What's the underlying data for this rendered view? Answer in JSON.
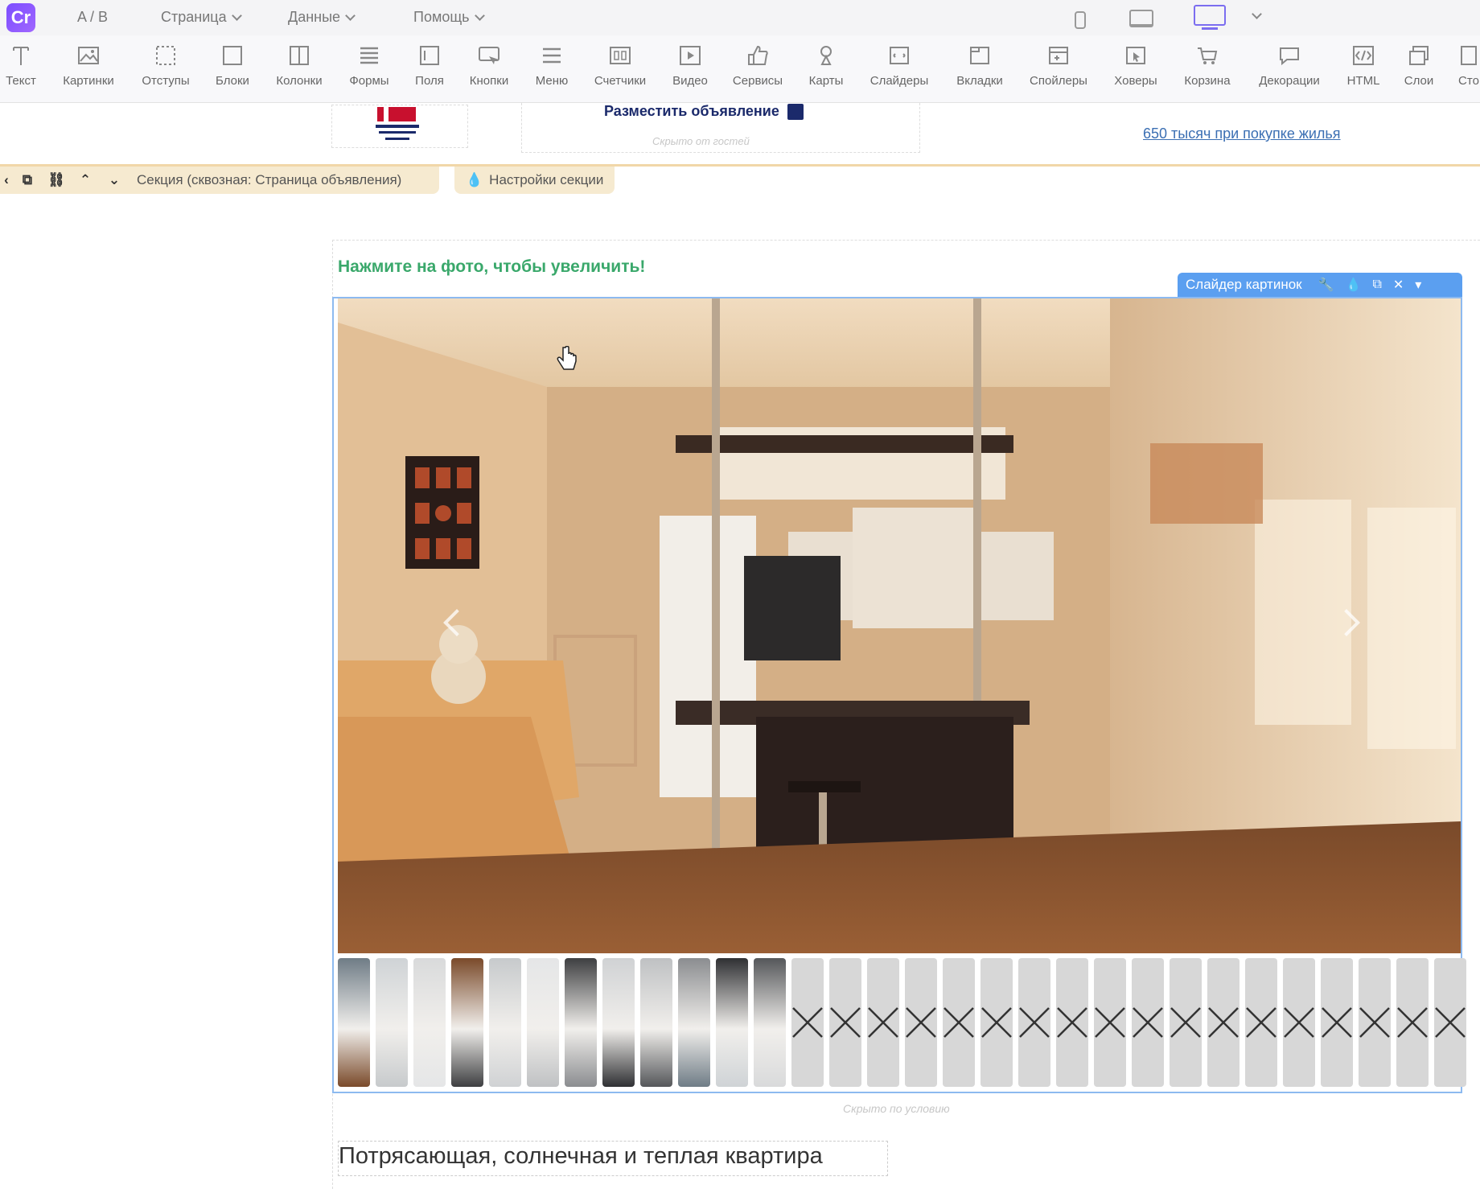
{
  "menubar": {
    "logo": "Cr",
    "ab": "A / B",
    "page": "Страница",
    "data": "Данные",
    "help": "Помощь"
  },
  "toolbar": [
    {
      "label": "Текст",
      "icon": "text-icon"
    },
    {
      "label": "Картинки",
      "icon": "image-icon"
    },
    {
      "label": "Отступы",
      "icon": "padding-icon"
    },
    {
      "label": "Блоки",
      "icon": "block-icon"
    },
    {
      "label": "Колонки",
      "icon": "columns-icon"
    },
    {
      "label": "Формы",
      "icon": "forms-icon"
    },
    {
      "label": "Поля",
      "icon": "fields-icon"
    },
    {
      "label": "Кнопки",
      "icon": "buttons-icon"
    },
    {
      "label": "Меню",
      "icon": "menu-icon"
    },
    {
      "label": "Счетчики",
      "icon": "counters-icon"
    },
    {
      "label": "Видео",
      "icon": "video-icon"
    },
    {
      "label": "Сервисы",
      "icon": "services-icon"
    },
    {
      "label": "Карты",
      "icon": "maps-icon"
    },
    {
      "label": "Слайдеры",
      "icon": "sliders-icon"
    },
    {
      "label": "Вкладки",
      "icon": "tabs-icon"
    },
    {
      "label": "Спойлеры",
      "icon": "spoilers-icon"
    },
    {
      "label": "Ховеры",
      "icon": "hovers-icon"
    },
    {
      "label": "Корзина",
      "icon": "cart-icon"
    },
    {
      "label": "Декорации",
      "icon": "decorations-icon"
    },
    {
      "label": "HTML",
      "icon": "html-icon"
    },
    {
      "label": "Слои",
      "icon": "layers-icon"
    },
    {
      "label": "Сто",
      "icon": "stop-icon"
    }
  ],
  "header": {
    "post_ad": "Разместить объявление",
    "hidden_note": "Скрыто от гостей",
    "link": "650 тысяч при покупке жилья"
  },
  "section": {
    "label": "Секция (сквозная: Страница объявления)",
    "settings": "Настройки секции"
  },
  "content": {
    "hint": "Нажмите на фото, чтобы увеличить!",
    "slider_label": "Слайдер картинок",
    "condition_note": "Скрыто по условию",
    "title": "Потрясающая, солнечная и теплая квартира"
  },
  "colors": {
    "brand": "#7b4dff",
    "hint_green": "#3aa86b",
    "slider_blue": "#5b9ff0",
    "section_bar": "#f6ead0",
    "link_blue": "#3b6fb3"
  },
  "thumbnails": {
    "photos": 12,
    "placeholders": 18
  }
}
